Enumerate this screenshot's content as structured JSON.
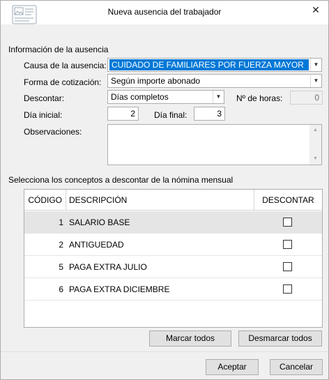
{
  "window": {
    "title": "Nueva ausencia del trabajador",
    "close_glyph": "✕"
  },
  "section_info": "Información de la ausencia",
  "causa": {
    "label": "Causa de la ausencia:",
    "value": "CUIDADO DE FAMILIARES POR FUERZA MAYOR"
  },
  "forma": {
    "label": "Forma de cotización:",
    "value": "Según importe abonado"
  },
  "descontar": {
    "label": "Descontar:",
    "value": "Días completos"
  },
  "horas": {
    "label": "Nº de horas:",
    "value": "0"
  },
  "dia_inicial": {
    "label": "Día inicial:",
    "value": "2"
  },
  "dia_final": {
    "label": "Día final:",
    "value": "3"
  },
  "observaciones": {
    "label": "Observaciones:",
    "value": ""
  },
  "section_conceptos": "Selecciona los conceptos a descontar de la nómina mensual",
  "table": {
    "columns": [
      "CÓDIGO",
      "DESCRIPCIÓN",
      "DESCONTAR"
    ],
    "rows": [
      {
        "codigo": "1",
        "descripcion": "SALARIO BASE",
        "descontar": false
      },
      {
        "codigo": "2",
        "descripcion": "ANTIGUEDAD",
        "descontar": false
      },
      {
        "codigo": "5",
        "descripcion": "PAGA EXTRA JULIO",
        "descontar": false
      },
      {
        "codigo": "6",
        "descripcion": "PAGA EXTRA DICIEMBRE",
        "descontar": false
      }
    ]
  },
  "buttons": {
    "marcar": "Marcar todos",
    "desmarcar": "Desmarcar todos",
    "aceptar": "Aceptar",
    "cancelar": "Cancelar"
  },
  "icons": {
    "dropdown": "▼",
    "scroll_up": "▲",
    "scroll_down": "▼"
  }
}
